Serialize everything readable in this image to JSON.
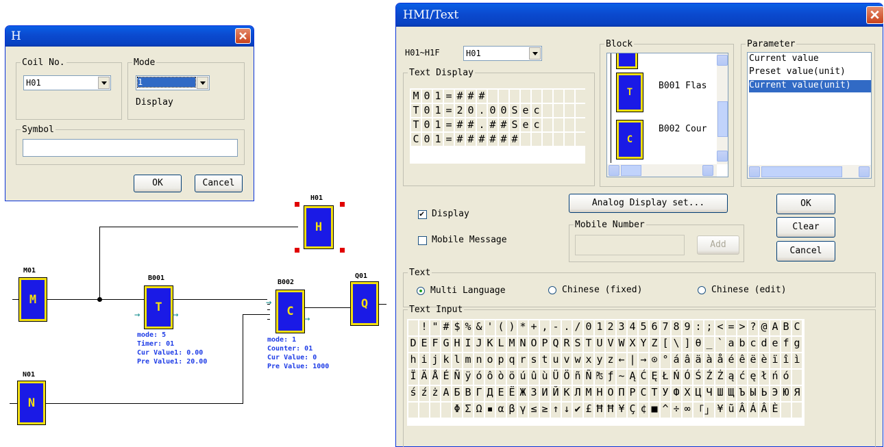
{
  "h_dialog": {
    "title": "H",
    "coil_group": "Coil No.",
    "coil_value": "H01",
    "mode_group": "Mode",
    "mode_value": "1",
    "display_label": "Display",
    "symbol_group": "Symbol",
    "symbol_value": "",
    "ok": "OK",
    "cancel": "Cancel"
  },
  "ladder": {
    "m01": {
      "label": "M01",
      "letter": "M"
    },
    "n01": {
      "label": "N01",
      "letter": "N"
    },
    "h01": {
      "label": "H01",
      "letter": "H"
    },
    "b001": {
      "label": "B001",
      "letter": "T",
      "info": [
        "mode: 5",
        "Timer: 01",
        "Cur Value1: 0.00",
        "Pre Value1: 20.00"
      ]
    },
    "b002": {
      "label": "B002",
      "letter": "C",
      "info": [
        "mode: 1",
        "Counter: 01",
        "Cur Value: 0",
        "Pre Value: 1000"
      ]
    },
    "q01": {
      "label": "Q01",
      "letter": "Q"
    }
  },
  "hmi": {
    "title": "HMI/Text",
    "range_label": "H01~H1F",
    "range_value": "H01",
    "text_display_group": "Text Display",
    "lcd_rows": [
      "M01=###",
      "T01=20.00Sec",
      "T01=##.##Sec",
      "C01=######"
    ],
    "block_group": "Block",
    "block_items": [
      "B001 Flas",
      "B002 Cour"
    ],
    "param_group": "Parameter",
    "param_items": [
      "Current value",
      "Preset value(unit)",
      "Current value(unit)"
    ],
    "analog_btn": "Analog Display set...",
    "ok": "OK",
    "clear": "Clear",
    "cancel": "Cancel",
    "display_chk": "Display",
    "mobile_chk": "Mobile Message",
    "mobile_group": "Mobile Number",
    "add_btn": "Add",
    "text_group": "Text",
    "radio_multi": "Multi Language",
    "radio_cn_fixed": "Chinese (fixed)",
    "radio_cn_edit": "Chinese (edit)",
    "text_input_group": "Text Input",
    "charmap_rows": [
      " !\"#$%&'()*+,-./0123456789:;<=>?@ABC",
      "DEFGHIJKLMNOPQRSTUVWXYZ[\\]θ_`abcdefg",
      "hijklmnopqrstuvwxyz←|→⊙°áâäàåéêëèïîì",
      "ÏÄÅÉÑÿóôòöúûùÜÖñÑ₧ƒ~ĄĆĘŁŃÓŚŹŻąćęłńó",
      "śźżАБВГДЕЁЖЗИЙКЛМНОПРСТУФХЦЧШЩЪЫЬЭЮЯ",
      "    ΦΣΩ▪αβγ≤≥↑↓✔£ĦĦ¥Ç¢■^÷∞「」¥ũÂÁÂÈ  "
    ]
  }
}
